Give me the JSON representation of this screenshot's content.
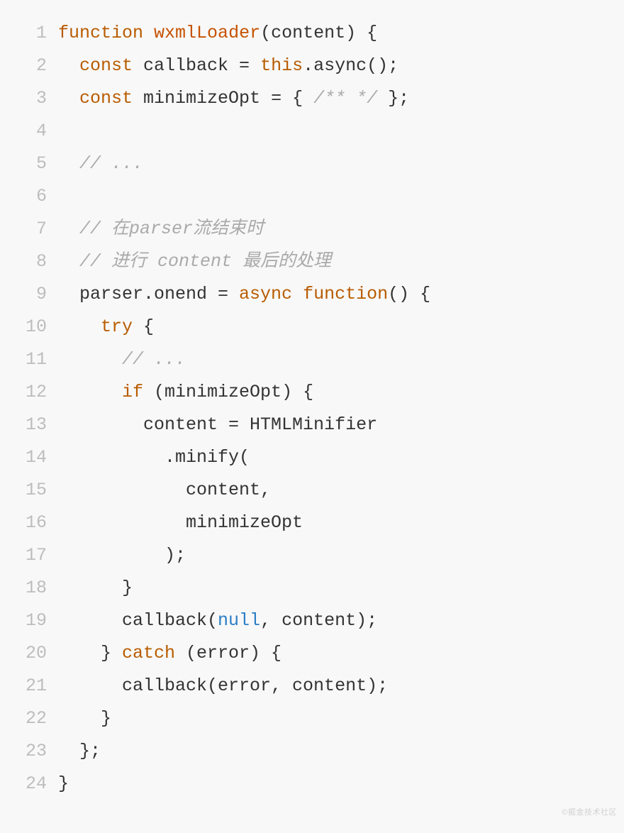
{
  "watermark": "©掘金技术社区",
  "lines": [
    {
      "n": "1",
      "tokens": [
        [
          "kw",
          "function"
        ],
        [
          "pn",
          " "
        ],
        [
          "fn",
          "wxmlLoader"
        ],
        [
          "pn",
          "(content) {"
        ]
      ]
    },
    {
      "n": "2",
      "tokens": [
        [
          "pn",
          "  "
        ],
        [
          "kw",
          "const"
        ],
        [
          "pn",
          " callback = "
        ],
        [
          "kw",
          "this"
        ],
        [
          "pn",
          ".async();"
        ]
      ]
    },
    {
      "n": "3",
      "tokens": [
        [
          "pn",
          "  "
        ],
        [
          "kw",
          "const"
        ],
        [
          "pn",
          " minimizeOpt = { "
        ],
        [
          "cm",
          "/** */"
        ],
        [
          "pn",
          " };"
        ]
      ]
    },
    {
      "n": "4",
      "tokens": [
        [
          "pn",
          ""
        ]
      ]
    },
    {
      "n": "5",
      "tokens": [
        [
          "pn",
          "  "
        ],
        [
          "cm",
          "// ..."
        ]
      ]
    },
    {
      "n": "6",
      "tokens": [
        [
          "pn",
          ""
        ]
      ]
    },
    {
      "n": "7",
      "tokens": [
        [
          "pn",
          "  "
        ],
        [
          "cm",
          "// 在parser流结束时"
        ]
      ]
    },
    {
      "n": "8",
      "tokens": [
        [
          "pn",
          "  "
        ],
        [
          "cm",
          "// 进行 content 最后的处理"
        ]
      ]
    },
    {
      "n": "9",
      "tokens": [
        [
          "pn",
          "  parser.onend = "
        ],
        [
          "kw",
          "async"
        ],
        [
          "pn",
          " "
        ],
        [
          "kw",
          "function"
        ],
        [
          "pn",
          "() {"
        ]
      ]
    },
    {
      "n": "10",
      "tokens": [
        [
          "pn",
          "    "
        ],
        [
          "kw",
          "try"
        ],
        [
          "pn",
          " {"
        ]
      ]
    },
    {
      "n": "11",
      "tokens": [
        [
          "pn",
          "      "
        ],
        [
          "cm",
          "// ..."
        ]
      ]
    },
    {
      "n": "12",
      "tokens": [
        [
          "pn",
          "      "
        ],
        [
          "kw",
          "if"
        ],
        [
          "pn",
          " (minimizeOpt) {"
        ]
      ]
    },
    {
      "n": "13",
      "tokens": [
        [
          "pn",
          "        content = HTMLMinifier"
        ]
      ]
    },
    {
      "n": "14",
      "tokens": [
        [
          "pn",
          "          .minify("
        ]
      ]
    },
    {
      "n": "15",
      "tokens": [
        [
          "pn",
          "            content,"
        ]
      ]
    },
    {
      "n": "16",
      "tokens": [
        [
          "pn",
          "            minimizeOpt"
        ]
      ]
    },
    {
      "n": "17",
      "tokens": [
        [
          "pn",
          "          );"
        ]
      ]
    },
    {
      "n": "18",
      "tokens": [
        [
          "pn",
          "      }"
        ]
      ]
    },
    {
      "n": "19",
      "tokens": [
        [
          "pn",
          "      callback("
        ],
        [
          "lit",
          "null"
        ],
        [
          "pn",
          ", content);"
        ]
      ]
    },
    {
      "n": "20",
      "tokens": [
        [
          "pn",
          "    } "
        ],
        [
          "kw",
          "catch"
        ],
        [
          "pn",
          " (error) {"
        ]
      ]
    },
    {
      "n": "21",
      "tokens": [
        [
          "pn",
          "      callback(error, content);"
        ]
      ]
    },
    {
      "n": "22",
      "tokens": [
        [
          "pn",
          "    }"
        ]
      ]
    },
    {
      "n": "23",
      "tokens": [
        [
          "pn",
          "  };"
        ]
      ]
    },
    {
      "n": "24",
      "tokens": [
        [
          "pn",
          "}"
        ]
      ]
    }
  ]
}
